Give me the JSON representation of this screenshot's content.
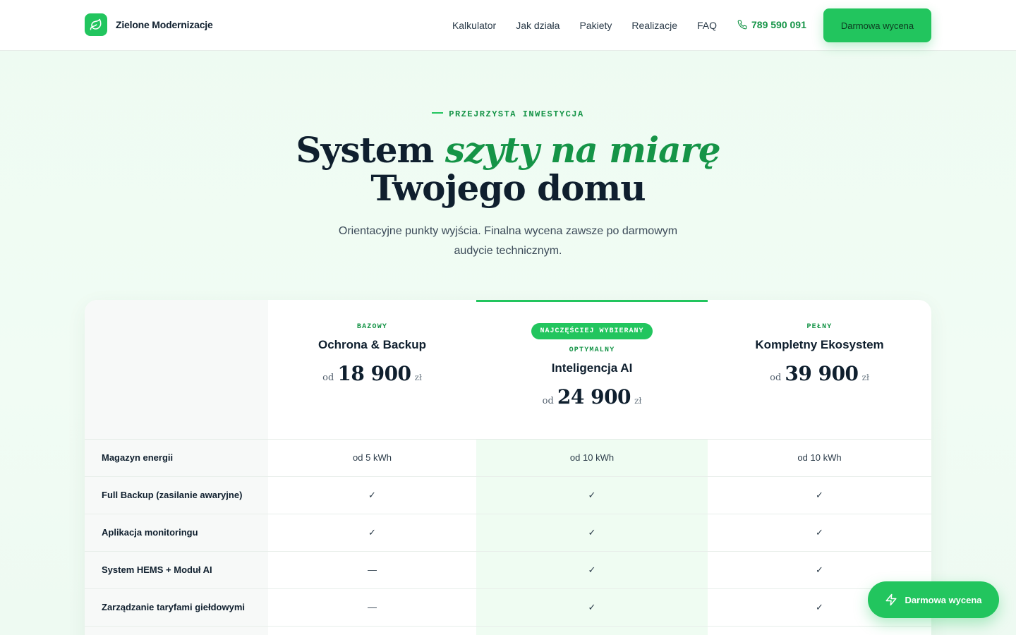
{
  "brand": {
    "name": "Zielone Modernizacje",
    "logo_icon": "leaf-icon"
  },
  "nav": {
    "items": [
      "Kalkulator",
      "Jak działa",
      "Pakiety",
      "Realizacje",
      "FAQ"
    ],
    "phone": "789 590 091",
    "phone_icon": "phone-icon",
    "cta": "Darmowa wycena"
  },
  "hero": {
    "eyebrow": "PRZEJRZYSTA INWESTYCJA",
    "title_start": "System ",
    "title_accent": "szyty na miarę",
    "title_end": "Twojego domu",
    "subtitle": "Orientacyjne punkty wyjścia. Finalna wycena zawsze po darmowym audycie technicznym."
  },
  "plans": [
    {
      "tier": "BAZOWY",
      "name": "Ochrona & Backup",
      "prefix": "od",
      "price": "18 900",
      "currency": "zł"
    },
    {
      "badge": "NAJCZĘŚCIEJ WYBIERANY",
      "tier": "OPTYMALNY",
      "name": "Inteligencja AI",
      "prefix": "od",
      "price": "24 900",
      "currency": "zł"
    },
    {
      "tier": "PEŁNY",
      "name": "Kompletny Ekosystem",
      "prefix": "od",
      "price": "39 900",
      "currency": "zł"
    }
  ],
  "features": [
    {
      "label": "Magazyn energii",
      "values": [
        "od 5 kWh",
        "od 10 kWh",
        "od 10 kWh"
      ]
    },
    {
      "label": "Full Backup (zasilanie awaryjne)",
      "values": [
        "✓",
        "✓",
        "✓"
      ]
    },
    {
      "label": "Aplikacja monitoringu",
      "values": [
        "✓",
        "✓",
        "✓"
      ]
    },
    {
      "label": "System HEMS + Moduł AI",
      "values": [
        "—",
        "✓",
        "✓"
      ]
    },
    {
      "label": "Zarządzanie taryfami giełdowymi",
      "values": [
        "—",
        "✓",
        "✓"
      ]
    }
  ],
  "floating_cta": {
    "label": "Darmowa wycena",
    "icon": "lightning-icon"
  },
  "colors": {
    "accent": "#22c55e",
    "accent_dark": "#159447",
    "text": "#0f1f2e"
  }
}
